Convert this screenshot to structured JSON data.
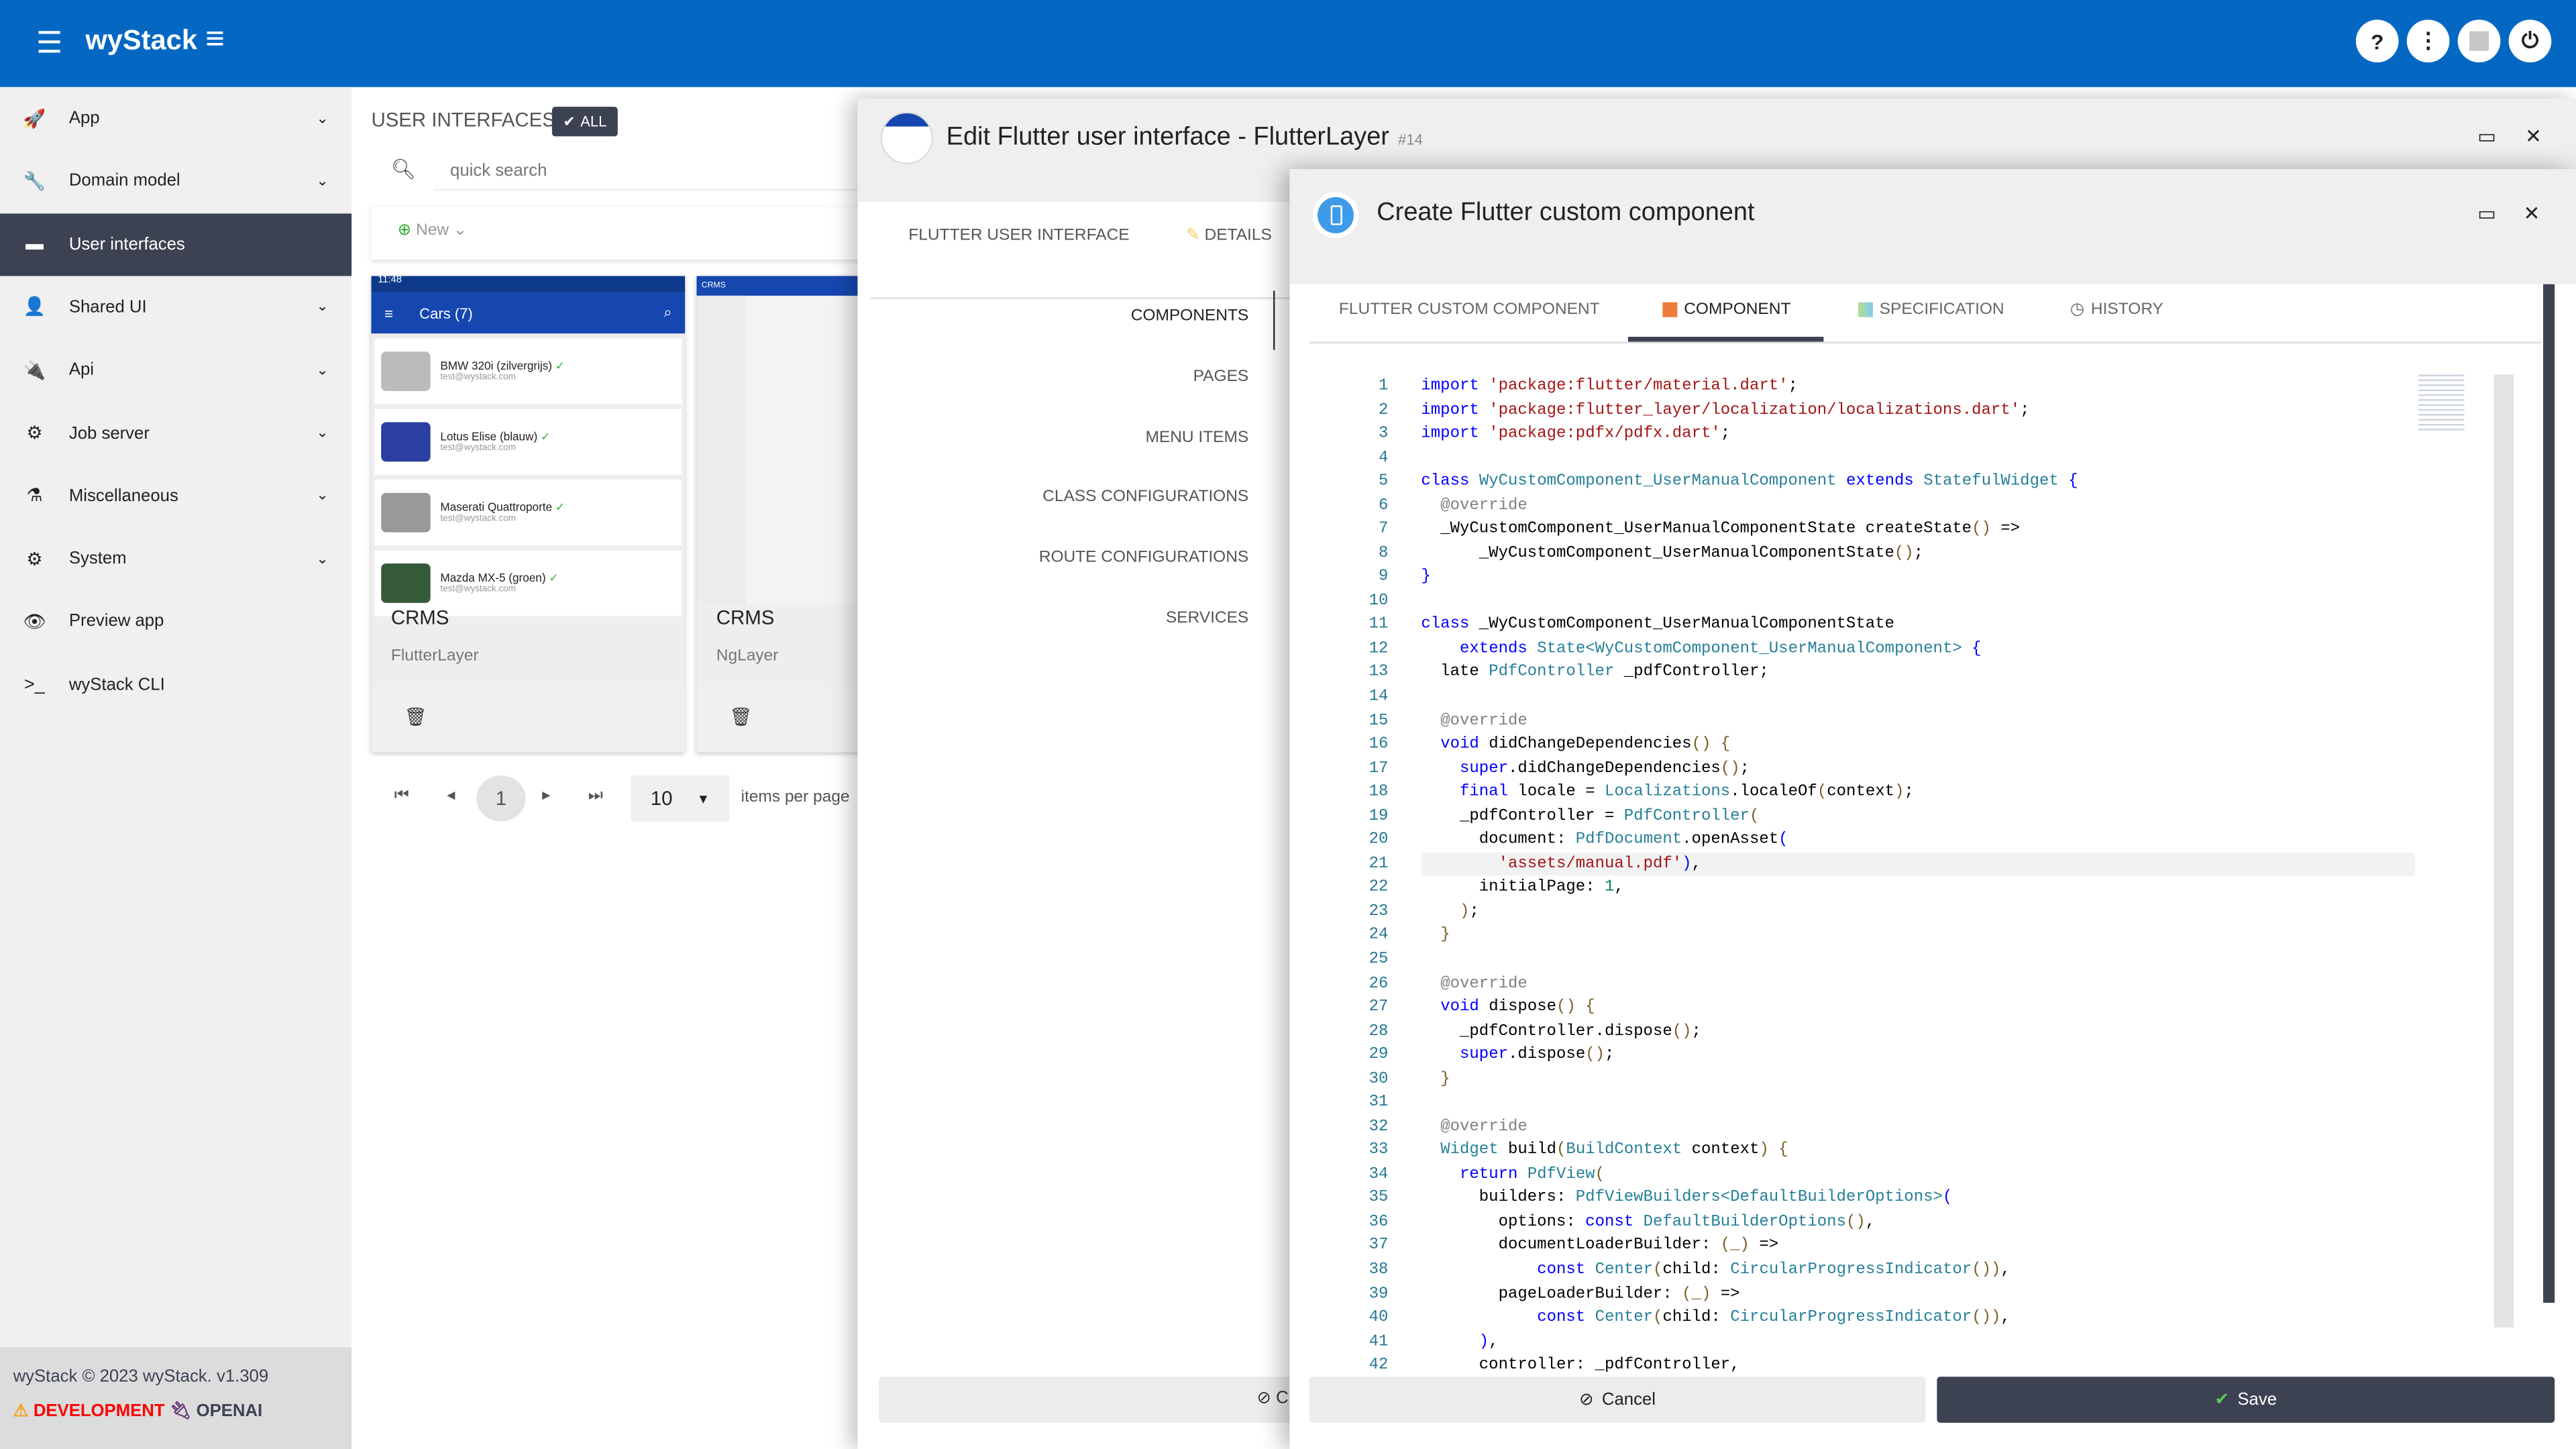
{
  "app": {
    "name": "wyStack",
    "header_color": "#0468c3",
    "header_buttons": [
      {
        "icon": "help-icon",
        "glyph": "?"
      },
      {
        "icon": "more-vertical-icon",
        "glyph": "⋮"
      },
      {
        "icon": "avatar-icon",
        "glyph": "👤"
      },
      {
        "icon": "power-icon",
        "glyph": "⏻"
      }
    ]
  },
  "sidebar": {
    "items": [
      {
        "label": "App",
        "icon": "rocket-icon",
        "glyph": "🚀",
        "expandable": true
      },
      {
        "label": "Domain model",
        "icon": "wrench-icon",
        "glyph": "🔧",
        "expandable": true
      },
      {
        "label": "User interfaces",
        "icon": "window-icon",
        "glyph": "▬",
        "active": true
      },
      {
        "label": "Shared UI",
        "icon": "user-icon",
        "glyph": "👤",
        "expandable": true
      },
      {
        "label": "Api",
        "icon": "plug-icon",
        "glyph": "🔌",
        "expandable": true
      },
      {
        "label": "Job server",
        "icon": "gear-icon",
        "glyph": "⚙",
        "expandable": true
      },
      {
        "label": "Miscellaneous",
        "icon": "flask-icon",
        "glyph": "⚗",
        "expandable": true
      },
      {
        "label": "System",
        "icon": "gears-icon",
        "glyph": "⚙",
        "expandable": true
      },
      {
        "label": "Preview app",
        "icon": "eye-icon",
        "glyph": "👁"
      },
      {
        "label": "wyStack CLI",
        "icon": "terminal-icon",
        "glyph": ">_"
      }
    ],
    "footer": {
      "copyright": "wyStack © 2023 wyStack. v1.309",
      "env": "DEVELOPMENT",
      "provider": "OPENAI"
    }
  },
  "main": {
    "title": "USER INTERFACES",
    "filter": "ALL",
    "search_placeholder": "quick search",
    "new_label": "New",
    "cards": [
      {
        "name": "CRMS",
        "sub": "FlutterLayer",
        "preview": {
          "time": "11:48",
          "title": "Cars (7)",
          "cars": [
            {
              "name": "BMW 320i (zilvergrijs)",
              "email": "test@wystack.com",
              "color": "#bbb"
            },
            {
              "name": "Lotus Elise (blauw)",
              "email": "test@wystack.com",
              "color": "#2a3fa0"
            },
            {
              "name": "Maserati Quattroporte",
              "email": "test@wystack.com",
              "color": "#999"
            },
            {
              "name": "Mazda MX-5 (groen)",
              "email": "test@wystack.com",
              "color": "#355a3a"
            }
          ]
        }
      },
      {
        "name": "CRMS",
        "sub": "NgLayer",
        "preview": {
          "title": "CRMS"
        }
      }
    ],
    "pager": {
      "page": "1",
      "per_page": "10",
      "per_page_label": "items per page"
    }
  },
  "dialog1": {
    "title": "Edit Flutter user interface - FlutterLayer",
    "id": "#14",
    "tabs": [
      "FLUTTER USER INTERFACE",
      "DETAILS"
    ],
    "nav": [
      "COMPONENTS",
      "PAGES",
      "MENU ITEMS",
      "CLASS CONFIGURATIONS",
      "ROUTE CONFIGURATIONS",
      "SERVICES"
    ],
    "cancel": "C"
  },
  "dialog2": {
    "title": "Create Flutter custom component",
    "tabs": [
      {
        "label": "FLUTTER CUSTOM COMPONENT"
      },
      {
        "label": "COMPONENT",
        "icon": "component-icon",
        "active": true
      },
      {
        "label": "SPECIFICATION",
        "icon": "specification-icon"
      },
      {
        "label": "HISTORY",
        "icon": "history-icon"
      }
    ],
    "cancel": "Cancel",
    "save": "Save",
    "current_line": 21,
    "code": [
      [
        [
          "k",
          "import"
        ],
        [
          "p",
          " "
        ],
        [
          "s",
          "'package:flutter/material.dart'"
        ],
        [
          "p",
          ";"
        ]
      ],
      [
        [
          "k",
          "import"
        ],
        [
          "p",
          " "
        ],
        [
          "s",
          "'package:flutter_layer/localization/localizations.dart'"
        ],
        [
          "p",
          ";"
        ]
      ],
      [
        [
          "k",
          "import"
        ],
        [
          "p",
          " "
        ],
        [
          "s",
          "'package:pdfx/pdfx.dart'"
        ],
        [
          "p",
          ";"
        ]
      ],
      [],
      [
        [
          "k",
          "class"
        ],
        [
          "p",
          " "
        ],
        [
          "t",
          "WyCustomComponent_UserManualComponent"
        ],
        [
          "p",
          " "
        ],
        [
          "k",
          "extends"
        ],
        [
          "p",
          " "
        ],
        [
          "t",
          "StatefulWidget"
        ],
        [
          "p",
          " "
        ],
        [
          "k",
          "{"
        ]
      ],
      [
        [
          "p",
          "  "
        ],
        [
          "a",
          "@override"
        ]
      ],
      [
        [
          "p",
          "  _WyCustomComponent_UserManualComponentState createState"
        ],
        [
          "b",
          "()"
        ],
        [
          "p",
          " =>"
        ]
      ],
      [
        [
          "p",
          "      _WyCustomComponent_UserManualComponentState"
        ],
        [
          "b",
          "()"
        ],
        [
          "p",
          ";"
        ]
      ],
      [
        [
          "k",
          "}"
        ]
      ],
      [],
      [
        [
          "k",
          "class"
        ],
        [
          "p",
          " _WyCustomComponent_UserManualComponentState"
        ]
      ],
      [
        [
          "p",
          "    "
        ],
        [
          "k",
          "extends"
        ],
        [
          "p",
          " "
        ],
        [
          "t",
          "State<WyCustomComponent_UserManualComponent>"
        ],
        [
          "p",
          " "
        ],
        [
          "k",
          "{"
        ]
      ],
      [
        [
          "p",
          "  late "
        ],
        [
          "t",
          "PdfController"
        ],
        [
          "p",
          " _pdfController;"
        ]
      ],
      [],
      [
        [
          "p",
          "  "
        ],
        [
          "a",
          "@override"
        ]
      ],
      [
        [
          "p",
          "  "
        ],
        [
          "k",
          "void"
        ],
        [
          "p",
          " didChangeDependencies"
        ],
        [
          "b",
          "()"
        ],
        [
          "p",
          " "
        ],
        [
          "b",
          "{"
        ]
      ],
      [
        [
          "p",
          "    "
        ],
        [
          "k",
          "super"
        ],
        [
          "p",
          ".didChangeDependencies"
        ],
        [
          "b",
          "()"
        ],
        [
          "p",
          ";"
        ]
      ],
      [
        [
          "p",
          "    "
        ],
        [
          "k",
          "final"
        ],
        [
          "p",
          " locale = "
        ],
        [
          "t",
          "Localizations"
        ],
        [
          "p",
          ".localeOf"
        ],
        [
          "b",
          "("
        ],
        [
          "p",
          "context"
        ],
        [
          "b",
          ")"
        ],
        [
          "p",
          ";"
        ]
      ],
      [
        [
          "p",
          "    _pdfController = "
        ],
        [
          "t",
          "PdfController"
        ],
        [
          "b",
          "("
        ]
      ],
      [
        [
          "p",
          "      document: "
        ],
        [
          "t",
          "PdfDocument"
        ],
        [
          "p",
          ".openAsset"
        ],
        [
          "k",
          "("
        ]
      ],
      [
        [
          "p",
          "        "
        ],
        [
          "s",
          "'assets/manual.pdf'"
        ],
        [
          "k",
          ")"
        ],
        [
          "p",
          ","
        ]
      ],
      [
        [
          "p",
          "      initialPage: "
        ],
        [
          "n",
          "1"
        ],
        [
          "p",
          ","
        ]
      ],
      [
        [
          "p",
          "    "
        ],
        [
          "b",
          ")"
        ],
        [
          "p",
          ";"
        ]
      ],
      [
        [
          "p",
          "  "
        ],
        [
          "b",
          "}"
        ]
      ],
      [],
      [
        [
          "p",
          "  "
        ],
        [
          "a",
          "@override"
        ]
      ],
      [
        [
          "p",
          "  "
        ],
        [
          "k",
          "void"
        ],
        [
          "p",
          " dispose"
        ],
        [
          "b",
          "()"
        ],
        [
          "p",
          " "
        ],
        [
          "b",
          "{"
        ]
      ],
      [
        [
          "p",
          "    _pdfController.dispose"
        ],
        [
          "b",
          "()"
        ],
        [
          "p",
          ";"
        ]
      ],
      [
        [
          "p",
          "    "
        ],
        [
          "k",
          "super"
        ],
        [
          "p",
          ".dispose"
        ],
        [
          "b",
          "()"
        ],
        [
          "p",
          ";"
        ]
      ],
      [
        [
          "p",
          "  "
        ],
        [
          "b",
          "}"
        ]
      ],
      [],
      [
        [
          "p",
          "  "
        ],
        [
          "a",
          "@override"
        ]
      ],
      [
        [
          "p",
          "  "
        ],
        [
          "t",
          "Widget"
        ],
        [
          "p",
          " build"
        ],
        [
          "b",
          "("
        ],
        [
          "t",
          "BuildContext"
        ],
        [
          "p",
          " context"
        ],
        [
          "b",
          ")"
        ],
        [
          "p",
          " "
        ],
        [
          "b",
          "{"
        ]
      ],
      [
        [
          "p",
          "    "
        ],
        [
          "k",
          "return"
        ],
        [
          "p",
          " "
        ],
        [
          "t",
          "PdfView"
        ],
        [
          "b",
          "("
        ]
      ],
      [
        [
          "p",
          "      builders: "
        ],
        [
          "t",
          "PdfViewBuilders<DefaultBuilderOptions>"
        ],
        [
          "k",
          "("
        ]
      ],
      [
        [
          "p",
          "        options: "
        ],
        [
          "k",
          "const"
        ],
        [
          "p",
          " "
        ],
        [
          "t",
          "DefaultBuilderOptions"
        ],
        [
          "b",
          "()"
        ],
        [
          "p",
          ","
        ]
      ],
      [
        [
          "p",
          "        documentLoaderBuilder: "
        ],
        [
          "b",
          "(_)"
        ],
        [
          "p",
          " =>"
        ]
      ],
      [
        [
          "p",
          "            "
        ],
        [
          "k",
          "const"
        ],
        [
          "p",
          " "
        ],
        [
          "t",
          "Center"
        ],
        [
          "b",
          "("
        ],
        [
          "p",
          "child: "
        ],
        [
          "t",
          "CircularProgressIndicator"
        ],
        [
          "b",
          "())"
        ],
        [
          "p",
          ","
        ]
      ],
      [
        [
          "p",
          "        pageLoaderBuilder: "
        ],
        [
          "b",
          "(_)"
        ],
        [
          "p",
          " =>"
        ]
      ],
      [
        [
          "p",
          "            "
        ],
        [
          "k",
          "const"
        ],
        [
          "p",
          " "
        ],
        [
          "t",
          "Center"
        ],
        [
          "b",
          "("
        ],
        [
          "p",
          "child: "
        ],
        [
          "t",
          "CircularProgressIndicator"
        ],
        [
          "b",
          "())"
        ],
        [
          "p",
          ","
        ]
      ],
      [
        [
          "p",
          "      "
        ],
        [
          "k",
          ")"
        ],
        [
          "p",
          ","
        ]
      ],
      [
        [
          "p",
          "      controller: _pdfController,"
        ]
      ]
    ]
  }
}
